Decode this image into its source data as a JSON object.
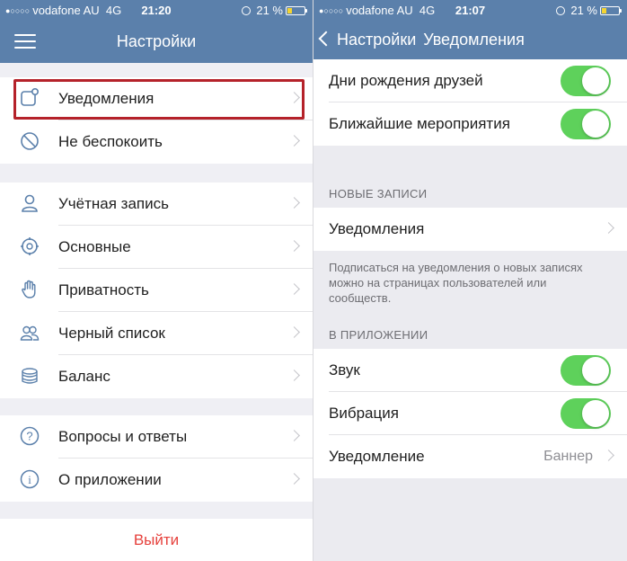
{
  "left": {
    "status": {
      "carrier": "vodafone AU",
      "network": "4G",
      "time": "21:20",
      "battery": "21 %"
    },
    "title": "Настройки",
    "group1": [
      {
        "label": "Уведомления",
        "icon": "notifications-icon"
      },
      {
        "label": "Не беспокоить",
        "icon": "do-not-disturb-icon"
      }
    ],
    "group2": [
      {
        "label": "Учётная запись",
        "icon": "account-icon"
      },
      {
        "label": "Основные",
        "icon": "general-icon"
      },
      {
        "label": "Приватность",
        "icon": "privacy-hand-icon"
      },
      {
        "label": "Черный список",
        "icon": "blacklist-icon"
      },
      {
        "label": "Баланс",
        "icon": "balance-icon"
      }
    ],
    "group3": [
      {
        "label": "Вопросы и ответы",
        "icon": "help-icon"
      },
      {
        "label": "О приложении",
        "icon": "info-icon"
      }
    ],
    "logout": "Выйти"
  },
  "right": {
    "status": {
      "carrier": "vodafone AU",
      "network": "4G",
      "time": "21:07",
      "battery": "21 %"
    },
    "back_label": "Настройки",
    "title": "Уведомления",
    "top_rows": [
      {
        "label": "Дни рождения друзей",
        "on": true
      },
      {
        "label": "Ближайшие мероприятия",
        "on": true
      }
    ],
    "new_posts_header": "НОВЫЕ ЗАПИСИ",
    "new_posts_row": "Уведомления",
    "new_posts_note": "Подписаться на уведомления о новых записях можно на страницах пользователей или сообществ.",
    "in_app_header": "В ПРИЛОЖЕНИИ",
    "sound": "Звук",
    "vibration": "Вибрация",
    "notification_label": "Уведомление",
    "notification_value": "Баннер"
  },
  "colors": {
    "navbar": "#5b80ab",
    "toggle_on": "#5ed15b",
    "logout": "#e6413c",
    "highlight": "#b5222a"
  }
}
